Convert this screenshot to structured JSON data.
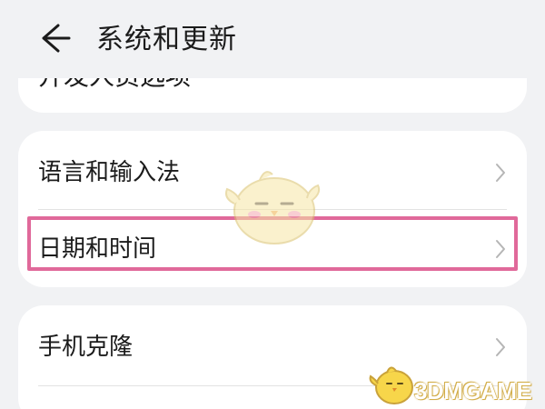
{
  "header": {
    "title": "系统和更新",
    "back_icon": "arrow-left-icon"
  },
  "top_card": {
    "partial_label": "开发人员选项"
  },
  "settings_group_1": [
    {
      "label": "语言和输入法",
      "icon": "chevron-right-icon"
    },
    {
      "label": "日期和时间",
      "icon": "chevron-right-icon",
      "highlighted": true
    }
  ],
  "settings_group_2": [
    {
      "label": "手机克隆",
      "icon": "chevron-right-icon"
    }
  ],
  "watermark": {
    "text": "3DMGAME",
    "mascot": "yellow-chick-mascot-icon"
  },
  "colors": {
    "background": "#f1f2f4",
    "card": "#ffffff",
    "highlight_border": "#e0699a",
    "text": "#1b1b1b",
    "chevron": "#b5b5b5"
  }
}
